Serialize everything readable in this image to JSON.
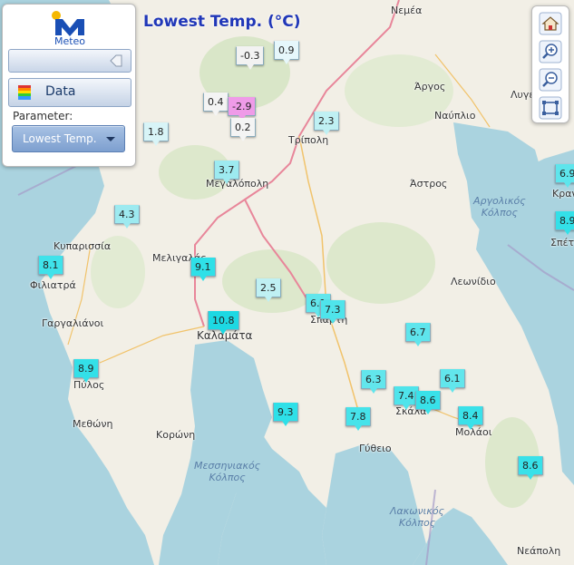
{
  "app": {
    "logo_text": "Meteo",
    "map_title": "Lowest Temp. (°C)"
  },
  "panel": {
    "data_button": "Data",
    "parameter_label": "Parameter:",
    "parameter_value": "Lowest Temp."
  },
  "toolbar": {
    "home_icon": "home-icon",
    "zoom_in_icon": "zoom-in-icon",
    "zoom_out_icon": "zoom-out-icon",
    "zoom_extent_icon": "zoom-extent-icon"
  },
  "places": [
    {
      "name": "Νεμέα"
    },
    {
      "name": "Άργος"
    },
    {
      "name": "Λυγε"
    },
    {
      "name": "Ναύπλιο"
    },
    {
      "name": "Τρίπολη"
    },
    {
      "name": "Μεγαλόπολη"
    },
    {
      "name": "Άστρος"
    },
    {
      "name": "Κυπαρισσία"
    },
    {
      "name": "Μελιγαλάς"
    },
    {
      "name": "Φιλιατρά"
    },
    {
      "name": "Λεωνίδιο"
    },
    {
      "name": "Γαργαλιάνοι"
    },
    {
      "name": "Σπάρτη"
    },
    {
      "name": "Καλαμάτα"
    },
    {
      "name": "Πύλος"
    },
    {
      "name": "Σκάλα"
    },
    {
      "name": "Μεθώνη"
    },
    {
      "name": "Μολάοι"
    },
    {
      "name": "Κορώνη"
    },
    {
      "name": "Γύθειο"
    },
    {
      "name": "Κρανί"
    },
    {
      "name": "Σπέτσ"
    },
    {
      "name": "Νεάπολη"
    }
  ],
  "seas": [
    {
      "name": "Αργολικός\nΚόλπος"
    },
    {
      "name": "Μεσσηνιακός\nΚόλπος"
    },
    {
      "name": "Λακωνικός\nΚόλπος"
    }
  ],
  "stations": [
    {
      "value": "-0.3",
      "color": "#f2f2f2"
    },
    {
      "value": "0.9",
      "color": "#e6f7fb"
    },
    {
      "value": "0.4",
      "color": "#f4f4f4"
    },
    {
      "value": "-2.9",
      "color": "#ef9be8"
    },
    {
      "value": "0.2",
      "color": "#f4f4f4"
    },
    {
      "value": "2.3",
      "color": "#bff0f3"
    },
    {
      "value": "1.8",
      "color": "#d8f4f7"
    },
    {
      "value": "3.7",
      "color": "#9deaf0"
    },
    {
      "value": "4.3",
      "color": "#9deaf0"
    },
    {
      "value": "9.1",
      "color": "#2fe0e8"
    },
    {
      "value": "8.1",
      "color": "#3fe2ea"
    },
    {
      "value": "2.5",
      "color": "#bff0f3"
    },
    {
      "value": "6.1",
      "color": "#62e6ec"
    },
    {
      "value": "7.3",
      "color": "#4fe4eb"
    },
    {
      "value": "10.8",
      "color": "#1dd9e3"
    },
    {
      "value": "6.7",
      "color": "#5ee5ec"
    },
    {
      "value": "8.9",
      "color": "#33e0e8"
    },
    {
      "value": "6.3",
      "color": "#62e6ec"
    },
    {
      "value": "6.1",
      "color": "#62e6ec"
    },
    {
      "value": "7.4",
      "color": "#4fe4eb"
    },
    {
      "value": "8.6",
      "color": "#38e1e9"
    },
    {
      "value": "8.4",
      "color": "#3ae1e9"
    },
    {
      "value": "9.3",
      "color": "#2ee0e8"
    },
    {
      "value": "7.8",
      "color": "#46e3ea"
    },
    {
      "value": "8.6",
      "color": "#38e1e9"
    },
    {
      "value": "6.9",
      "color": "#5ee5ec"
    },
    {
      "value": "8.9",
      "color": "#33e0e8"
    }
  ]
}
